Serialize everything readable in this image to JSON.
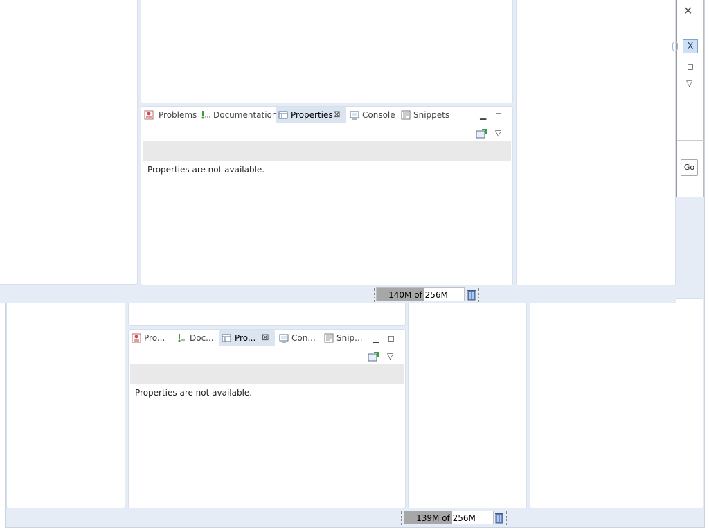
{
  "window_top": {
    "tabs": [
      {
        "label": "Problems",
        "icon": "problems-icon"
      },
      {
        "label": "Documentation",
        "icon": "documentation-icon"
      },
      {
        "label": "Properties",
        "icon": "properties-icon",
        "active": true
      },
      {
        "label": "Console",
        "icon": "console-icon"
      },
      {
        "label": "Snippets",
        "icon": "snippets-icon"
      }
    ],
    "message": "Properties are not available.",
    "heap": {
      "label": "140M of 256M",
      "used_fraction": 0.55
    },
    "go_label": "Go",
    "right_toolbar_label": "X"
  },
  "window_bottom": {
    "tabs": [
      {
        "label": "Pro...",
        "icon": "problems-icon"
      },
      {
        "label": "Doc...",
        "icon": "documentation-icon"
      },
      {
        "label": "Pro...",
        "icon": "properties-icon",
        "active": true
      },
      {
        "label": "Con...",
        "icon": "console-icon"
      },
      {
        "label": "Snip...",
        "icon": "snippets-icon"
      }
    ],
    "message": "Properties are not available.",
    "heap": {
      "label": "139M of 256M",
      "used_fraction": 0.54
    }
  }
}
